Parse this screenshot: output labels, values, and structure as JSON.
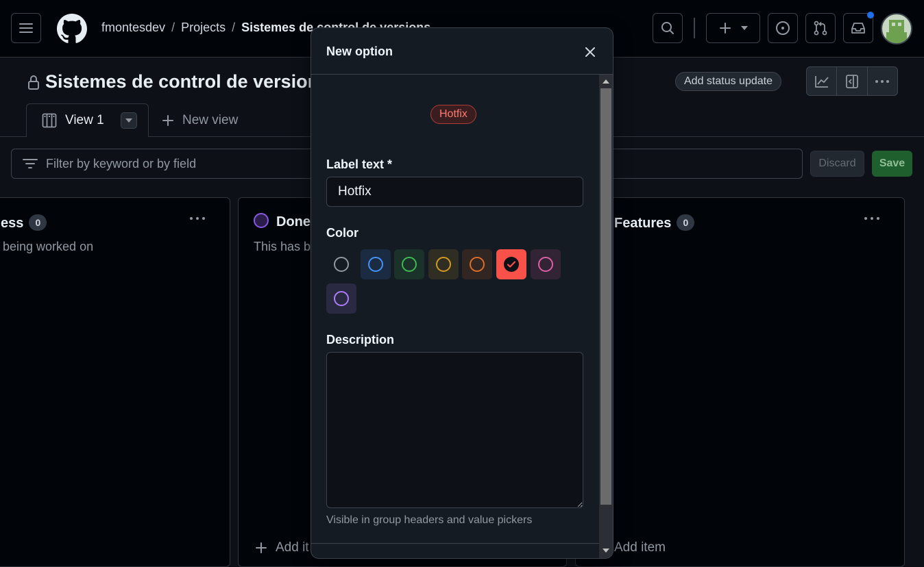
{
  "header": {
    "breadcrumb": {
      "owner": "fmontesdev",
      "section": "Projects",
      "project": "Sistemes de control de versions"
    }
  },
  "project": {
    "title": "Sistemes de control de versions",
    "status_button": "Add status update"
  },
  "tabs": {
    "active_label": "View 1",
    "new_view_label": "New view"
  },
  "filter": {
    "placeholder": "Filter by keyword or by field",
    "discard_label": "Discard",
    "save_label": "Save"
  },
  "columns": [
    {
      "name": "ess",
      "count": "0",
      "description": "being worked on",
      "add_label": ""
    },
    {
      "name": "Done",
      "count": "",
      "description": "This has b",
      "add_label": "Add it"
    },
    {
      "name": "Features",
      "count": "0",
      "description": "",
      "add_label": "Add item"
    }
  ],
  "modal": {
    "title": "New option",
    "preview_label": "Hotfix",
    "label_field": {
      "label": "Label text *",
      "value": "Hotfix"
    },
    "color_field": {
      "label": "Color",
      "options": [
        {
          "name": "gray",
          "hex": "#9198a1"
        },
        {
          "name": "blue",
          "hex": "#4493f8"
        },
        {
          "name": "green",
          "hex": "#3fb950"
        },
        {
          "name": "yellow",
          "hex": "#d29922"
        },
        {
          "name": "orange",
          "hex": "#db6d28"
        },
        {
          "name": "red",
          "hex": "#f85149",
          "selected": true
        },
        {
          "name": "pink",
          "hex": "#db61a2"
        },
        {
          "name": "purple",
          "hex": "#ab7df8"
        }
      ]
    },
    "description_field": {
      "label": "Description",
      "value": "",
      "hint": "Visible in group headers and value pickers"
    }
  }
}
